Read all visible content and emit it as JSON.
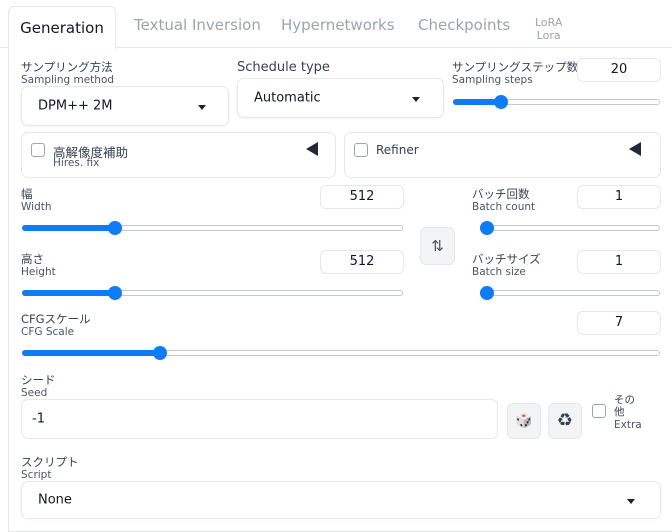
{
  "tabs": [
    {
      "label": "Generation",
      "active": true
    },
    {
      "label": "Textual Inversion"
    },
    {
      "label": "Hypernetworks"
    },
    {
      "label": "Checkpoints"
    },
    {
      "label_ja": "LoRA",
      "label_en": "Lora"
    }
  ],
  "sampling_method": {
    "label_ja": "サンプリング方法",
    "label_en": "Sampling method",
    "value": "DPM++ 2M"
  },
  "schedule_type": {
    "label": "Schedule type",
    "value": "Automatic"
  },
  "sampling_steps": {
    "label_ja": "サンプリングステップ数",
    "label_en": "Sampling steps",
    "value": "20",
    "slider_fraction": 0.21
  },
  "hires_fix": {
    "label_ja": "高解像度補助",
    "label_en": "Hires. fix",
    "checked": false
  },
  "refiner": {
    "label": "Refiner",
    "checked": false
  },
  "width": {
    "label_ja": "幅",
    "label_en": "Width",
    "value": "512",
    "slider_fraction": 0.235
  },
  "height": {
    "label_ja": "高さ",
    "label_en": "Height",
    "value": "512",
    "slider_fraction": 0.235
  },
  "batch_count": {
    "label_ja": "バッチ回数",
    "label_en": "Batch count",
    "value": "1",
    "slider_fraction": 0.0
  },
  "batch_size": {
    "label_ja": "バッチサイズ",
    "label_en": "Batch size",
    "value": "1",
    "slider_fraction": 0.0
  },
  "swap_button": {
    "icon": "swap-vertical-icon",
    "glyph": "⇅"
  },
  "cfg_scale": {
    "label_ja": "CFGスケール",
    "label_en": "CFG Scale",
    "value": "7",
    "slider_fraction": 0.21
  },
  "seed": {
    "label_ja": "シード",
    "label_en": "Seed",
    "value": "-1"
  },
  "seed_buttons": {
    "dice_icon": "dice-icon",
    "dice_glyph": "🎲",
    "recycle_icon": "recycle-icon",
    "recycle_glyph": "♻"
  },
  "extra": {
    "label_ja_1": "その",
    "label_ja_2": "他",
    "label_en": "Extra",
    "checked": false
  },
  "script": {
    "label_ja": "スクリプト",
    "label_en": "Script",
    "value": "None"
  },
  "colors": {
    "accent": "#0f7cf5",
    "border": "#e5e7eb"
  }
}
